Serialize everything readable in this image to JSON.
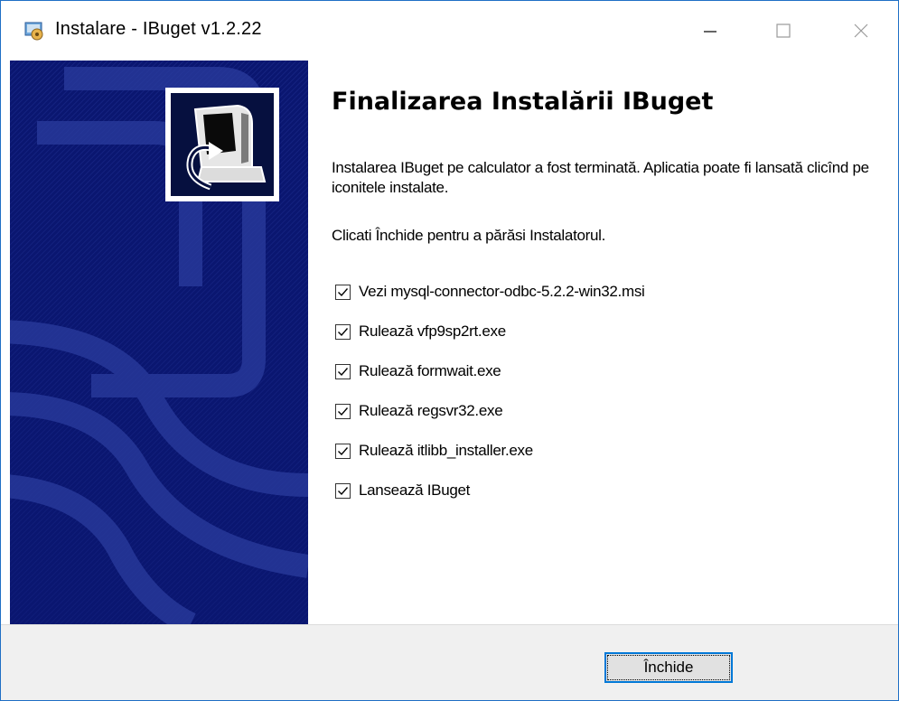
{
  "window": {
    "title": "Instalare - IBuget v1.2.22"
  },
  "heading": "Finalizarea Instalării IBuget",
  "message": "Instalarea IBuget pe calculator a fost terminată. Aplicatia poate fi lansată clicînd pe iconitele instalate.",
  "instruction": "Clicati Închide pentru a părăsi Instalatorul.",
  "options": [
    {
      "label": "Vezi mysql-connector-odbc-5.2.2-win32.msi",
      "checked": true
    },
    {
      "label": "Rulează vfp9sp2rt.exe",
      "checked": true
    },
    {
      "label": "Rulează formwait.exe",
      "checked": true
    },
    {
      "label": "Rulează regsvr32.exe",
      "checked": true
    },
    {
      "label": "Rulează itlibb_installer.exe",
      "checked": true
    },
    {
      "label": "Lansează IBuget",
      "checked": true
    }
  ],
  "buttons": {
    "close": "Închide"
  },
  "colors": {
    "banner": "#0a1670",
    "accent": "#0078d7"
  }
}
